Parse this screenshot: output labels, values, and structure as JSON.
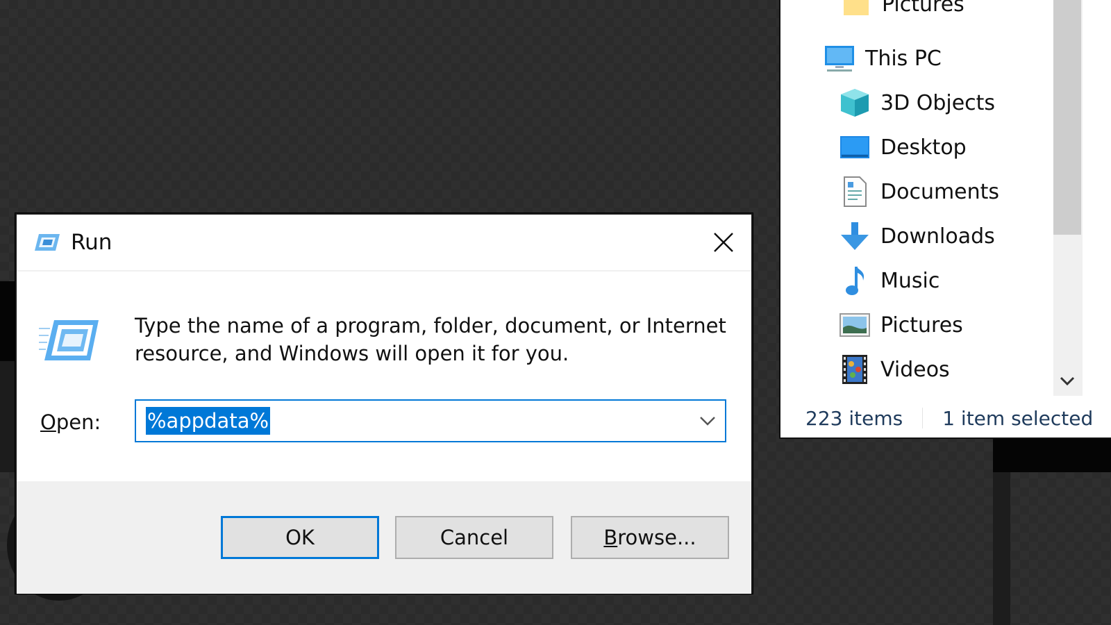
{
  "explorer": {
    "nav_items": [
      {
        "label": "Pictures",
        "icon": "folder-pictures-icon",
        "level": 1,
        "partial": true
      },
      {
        "label": "This PC",
        "icon": "this-pc-icon",
        "level": 0
      },
      {
        "label": "3D Objects",
        "icon": "3d-objects-icon",
        "level": 1
      },
      {
        "label": "Desktop",
        "icon": "desktop-icon",
        "level": 1
      },
      {
        "label": "Documents",
        "icon": "documents-icon",
        "level": 1
      },
      {
        "label": "Downloads",
        "icon": "downloads-icon",
        "level": 1
      },
      {
        "label": "Music",
        "icon": "music-icon",
        "level": 1
      },
      {
        "label": "Pictures",
        "icon": "pictures-icon",
        "level": 1
      },
      {
        "label": "Videos",
        "icon": "videos-icon",
        "level": 1
      }
    ],
    "status": {
      "item_count": "223 items",
      "selection": "1 item selected"
    }
  },
  "run_dialog": {
    "title": "Run",
    "description": "Type the name of a program, folder, document, or Internet resource, and Windows will open it for you.",
    "open_label_mnemonic": "O",
    "open_label_rest": "pen:",
    "open_value": "%appdata%",
    "buttons": {
      "ok": "OK",
      "cancel": "Cancel",
      "browse_mnemonic": "B",
      "browse_rest": "rowse..."
    }
  },
  "colors": {
    "accent": "#0078d7",
    "dialog_footer": "#f0f0f0",
    "desktop_bg": "#2f2f2f"
  }
}
